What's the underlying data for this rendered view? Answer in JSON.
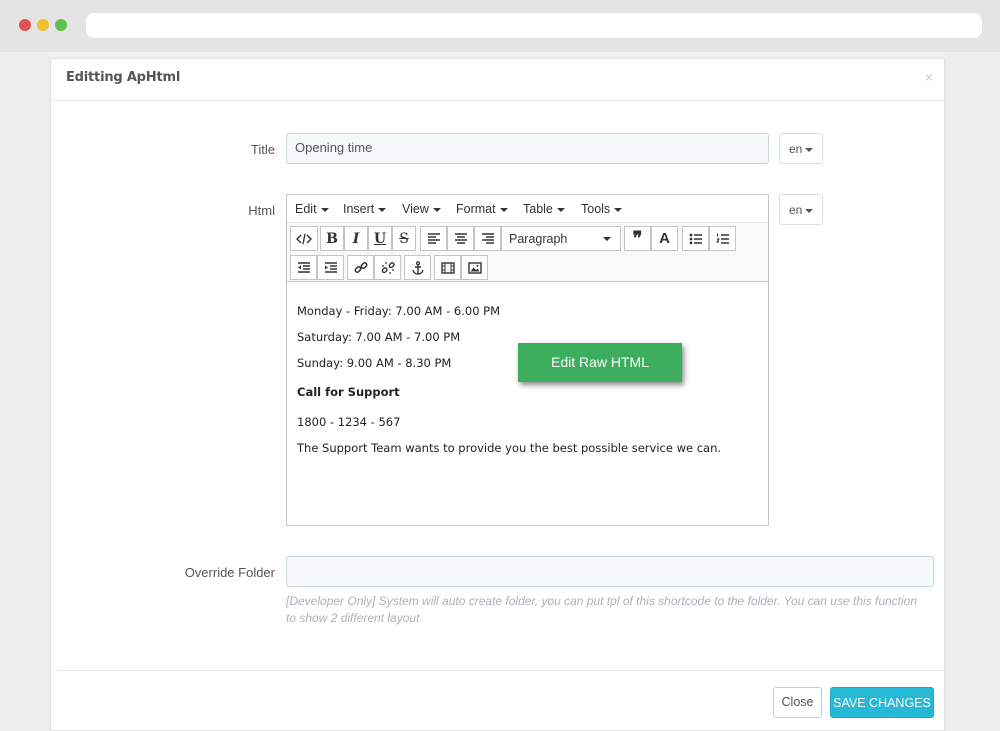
{
  "modal": {
    "title": "Editting ApHtml",
    "close_glyph": "×"
  },
  "form": {
    "title_label": "Title",
    "title_value": "Opening time",
    "title_lang": "en",
    "html_label": "Html",
    "html_lang": "en",
    "override_label": "Override Folder",
    "override_value": "",
    "override_help": "[Developer Only] System will auto create folder, you can put tpl of this shortcode to the folder. You can use this function to show 2 different layout"
  },
  "editor": {
    "menus": [
      "Edit",
      "Insert",
      "View",
      "Format",
      "Table",
      "Tools"
    ],
    "format_select": "Paragraph",
    "toolbar_icons": [
      "code-icon",
      "bold-icon",
      "italic-icon",
      "underline-icon",
      "strikethrough-icon",
      "align-left-icon",
      "align-center-icon",
      "align-right-icon",
      "blockquote-icon",
      "text-color-icon",
      "bullet-list-icon",
      "numbered-list-icon",
      "outdent-icon",
      "indent-icon",
      "link-icon",
      "unlink-icon",
      "anchor-icon",
      "media-icon",
      "image-icon"
    ],
    "content": {
      "line1": "Monday - Friday: 7.00 AM - 6.00 PM",
      "line2": "Saturday: 7.00 AM - 7.00 PM",
      "line3": "Sunday: 9.00 AM - 8.30 PM",
      "line4": "Call for Support",
      "line5": "1800 - 1234 - 567",
      "line6": "The Support Team wants to provide you the best possible service we can."
    },
    "raw_button": "Edit Raw HTML"
  },
  "footer": {
    "close_label": "Close",
    "save_label": "SAVE CHANGES"
  },
  "colors": {
    "save_button": "#25b9d7",
    "raw_button": "#3cae5d"
  }
}
